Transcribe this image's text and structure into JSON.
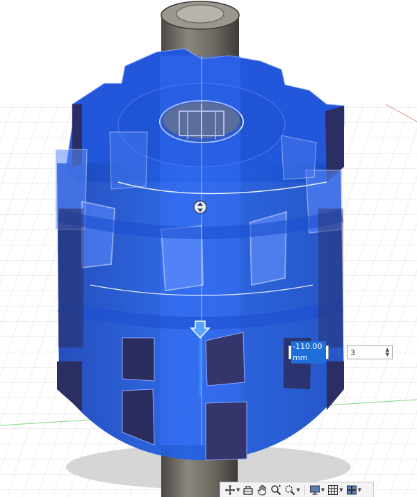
{
  "feature_dialog": {
    "distance_value": "-110.00 mm",
    "quantity_value": "3"
  },
  "navigation_bar": {
    "tools": [
      {
        "name": "orbit",
        "has_menu": true
      },
      {
        "name": "look-at",
        "has_menu": false
      },
      {
        "name": "pan",
        "has_menu": false
      },
      {
        "name": "zoom",
        "has_menu": false
      },
      {
        "name": "fit",
        "has_menu": true
      },
      {
        "name": "display-settings",
        "has_menu": true
      },
      {
        "name": "grid-and-snaps",
        "has_menu": true
      },
      {
        "name": "viewports",
        "has_menu": true
      }
    ]
  },
  "colors": {
    "body_blue": "#1f57d8",
    "body_dark": "#2a2c5e",
    "shaft_gray": "#6c6a64",
    "grid_line": "#d9d9d9",
    "accent_blue": "#1e6fd9"
  }
}
